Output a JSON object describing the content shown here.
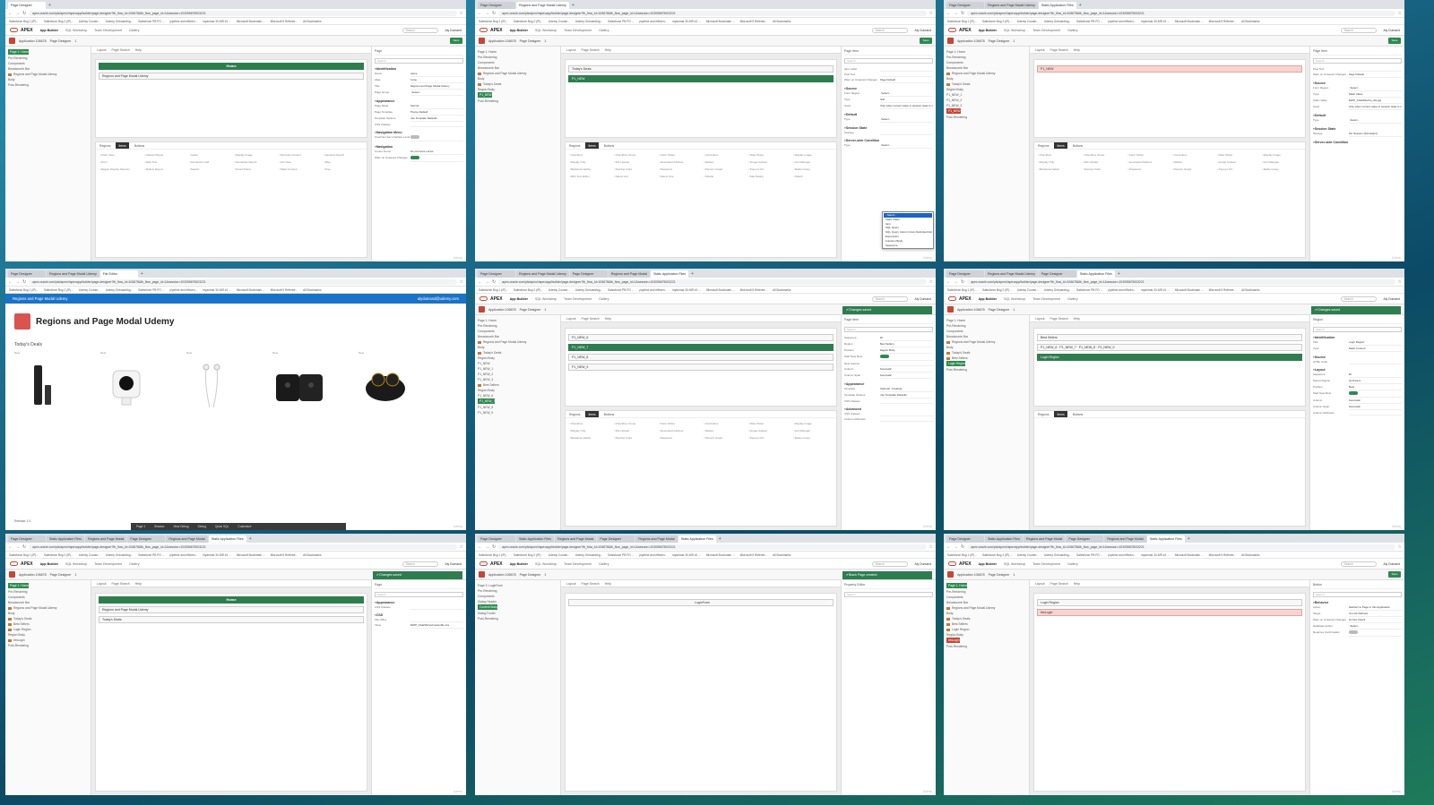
{
  "browser": {
    "url": "apex.oracle.com/pls/apex/r/apexapp/builder/page-designer?fb_flow_id=106678&fb_flow_page_id=1&session=103055675003221",
    "bookmarks": [
      "Salesforce Bug 1 (IP)...",
      "Salesforce Bug 2 (IP)...",
      "Udemy Course...",
      "Udemy Onboarding...",
      "Salesforce PB PO ...",
      "pipeline and efficien...",
      "myanmar 30-MR #1 ...",
      "Microsoft Bookmark ...",
      "Microsoft 5 Referee...",
      "All Bookmarks"
    ]
  },
  "apex": {
    "logo": "APEX",
    "app_builder": "App Builder",
    "nav": [
      "SQL Workshop",
      "Team Development",
      "Gallery"
    ],
    "search_placeholder": "Search",
    "user": "Aly Dumand",
    "app_name": "Application 106678",
    "page_designer": "Page Designer",
    "page_number": "1",
    "save": "Save"
  },
  "tiles": [
    {
      "tabs": [
        "Page Designer"
      ],
      "tree": [
        {
          "t": "Page 1: Home",
          "cls": "sel"
        },
        {
          "t": "Pre-Rendering"
        },
        {
          "t": "Components"
        },
        {
          "t": "Breadcrumb Bar"
        },
        {
          "t": "Regions and Page Modal Udemy",
          "ic": true
        },
        {
          "t": "Body"
        },
        {
          "t": "Post-Rendering"
        }
      ],
      "center_tabs": [
        "Layout",
        "Page Search",
        "Help"
      ],
      "regions": [
        {
          "t": "Home",
          "cls": "band"
        },
        {
          "t": "Regions and Page Modal Udemy"
        }
      ],
      "gallery_tabs": [
        "Regions",
        "Items",
        "Buttons"
      ],
      "gallery_items": [
        "Chart View",
        "Classic Report",
        "Cards",
        "Display Image",
        "Dynamic Content",
        "Faceted Search",
        "Form",
        "Help Text",
        "Interactive Grid",
        "Interactive Report",
        "List View",
        "Map",
        "Region Display Selector",
        "Reflow Report",
        "Search",
        "Smart Filters",
        "Static Content",
        "Tree"
      ],
      "prop_head": "Page",
      "props": [
        {
          "g": "Identification"
        },
        {
          "k": "Name",
          "v": "Home"
        },
        {
          "k": "Alias",
          "v": "home"
        },
        {
          "k": "Title",
          "v": "Regions and Page Modal Udemy"
        },
        {
          "k": "Page Group",
          "v": "- Select -"
        },
        {
          "g": "Appearance"
        },
        {
          "k": "Page Mode",
          "v": "Normal"
        },
        {
          "k": "Page Template",
          "v": "Theme Default"
        },
        {
          "k": "Template Options",
          "v": "Use Template Defaults"
        },
        {
          "k": "CSS Classes",
          "v": ""
        },
        {
          "g": "Navigation Menu"
        },
        {
          "k": "Override User Interface Level",
          "toggle": "off"
        },
        {
          "g": "Navigation"
        },
        {
          "k": "Cursor Focus",
          "v": "Do not focus cursor"
        },
        {
          "k": "Warn on Unsaved Changes",
          "toggle": "on"
        }
      ]
    },
    {
      "tabs": [
        "Page Designer",
        "Regions and Page Modal Udemy"
      ],
      "tree": [
        {
          "t": "Page 1: Home"
        },
        {
          "t": "Pre-Rendering"
        },
        {
          "t": "Components"
        },
        {
          "t": "Breadcrumb Bar"
        },
        {
          "t": "Regions and Page Modal Udemy",
          "ic": true
        },
        {
          "t": "Body"
        },
        {
          "t": "Today's Deals",
          "ic": true
        },
        {
          "t": "Region Body"
        },
        {
          "t": "P1_NEW",
          "cls": "sel"
        },
        {
          "t": "Post-Rendering"
        }
      ],
      "center_tabs": [
        "Layout",
        "Page Search",
        "Help"
      ],
      "regions": [
        {
          "t": "Today's Deals"
        },
        {
          "t": "P1_NEW",
          "cls": "green"
        }
      ],
      "gallery_tabs": [
        "Regions",
        "Items",
        "Buttons"
      ],
      "gallery_items": [
        "Checkbox",
        "Checkbox Group",
        "Color Picker",
        "Combobox",
        "Date Picker",
        "Display Image",
        "Display Only",
        "File Upload",
        "Geocoded Address",
        "Hidden",
        "Image Upload",
        "List Manager",
        "Markdown Editor",
        "Number Field",
        "Password",
        "Percent Graph",
        "Popup LOV",
        "Radio Group",
        "Rich Text Editor",
        "Select List",
        "Select One",
        "Shuttle",
        "Star Rating",
        "Switch"
      ],
      "prop_head": "Page Item",
      "props": [
        {
          "k": "Item Label",
          "v": ""
        },
        {
          "k": "Post Text",
          "v": ""
        },
        {
          "k": "Warn on Unsaved Changes",
          "v": "Page Default"
        },
        {
          "g": "Source"
        },
        {
          "k": "Form Region",
          "v": "- Select -"
        },
        {
          "k": "Type",
          "v": "Null"
        },
        {
          "k": "Used",
          "v": "Only when current value in session state is null"
        },
        {
          "g": "Default"
        },
        {
          "k": "Type",
          "v": "- Select -"
        },
        {
          "g": "Session State"
        },
        {
          "k": "Storage",
          "v": ""
        },
        {
          "g": "Server-side Condition"
        },
        {
          "k": "Type",
          "v": "- Select -"
        }
      ],
      "dropdown": [
        "- Select -",
        "Static Value",
        "Item",
        "SQL Query",
        "SQL Query (return Colon Delimited list)",
        "Expression",
        "Function Body",
        "Sequence"
      ]
    },
    {
      "tabs": [
        "Page Designer",
        "Regions and Page Modal Udemy",
        "Static Application Files"
      ],
      "tree": [
        {
          "t": "Page 1: Home"
        },
        {
          "t": "Pre-Rendering"
        },
        {
          "t": "Components"
        },
        {
          "t": "Breadcrumb Bar"
        },
        {
          "t": "Regions and Page Modal Udemy",
          "ic": true
        },
        {
          "t": "Body"
        },
        {
          "t": "Today's Deals",
          "ic": true
        },
        {
          "t": "Region Body"
        },
        {
          "t": "P1_NEW_1"
        },
        {
          "t": "P1_NEW_2"
        },
        {
          "t": "P1_NEW_3"
        },
        {
          "t": "P1_NEW",
          "cls": "del"
        },
        {
          "t": "Post-Rendering"
        }
      ],
      "center_tabs": [
        "Layout",
        "Page Search",
        "Help"
      ],
      "regions": [
        {
          "t": "P1_NEW",
          "cls": "pink"
        }
      ],
      "gallery_tabs": [
        "Regions",
        "Items",
        "Buttons"
      ],
      "gallery_items": [
        "Checkbox",
        "Checkbox Group",
        "Color Picker",
        "Combobox",
        "Date Picker",
        "Display Image",
        "Display Only",
        "File Upload",
        "Geocoded Address",
        "Hidden",
        "Image Upload",
        "List Manager",
        "Markdown Editor",
        "Number Field",
        "Password",
        "Percent Graph",
        "Popup LOV",
        "Radio Group"
      ],
      "prop_head": "Page Item",
      "props": [
        {
          "k": "Post Text",
          "v": ""
        },
        {
          "k": "Warn on Unsaved Changes",
          "v": "Page Default"
        },
        {
          "g": "Source"
        },
        {
          "k": "Form Region",
          "v": "- Select -"
        },
        {
          "k": "Type",
          "v": "Static Value"
        },
        {
          "k": "Static Value",
          "v": "#APP_FILES#echo_dot.jpg"
        },
        {
          "k": "Used",
          "v": "Only when current value in session state is null"
        },
        {
          "g": "Default"
        },
        {
          "k": "Type",
          "v": "- Select -"
        },
        {
          "g": "Session State"
        },
        {
          "k": "Storage",
          "v": "Per Session (Persistent)"
        },
        {
          "g": "Server-side Condition"
        }
      ]
    },
    {
      "tabs": [
        "Page Designer",
        "Regions and Page Modal Udemy",
        "File Editor"
      ],
      "runtime": true,
      "runtime_header": "Regions and Page Modal Udemy",
      "runtime_user": "alydumand@udemy.com",
      "runtime_title": "Regions and Page Modal Udemy",
      "runtime_section": "Today's Deals",
      "products": [
        {
          "label": "New",
          "kind": "stick"
        },
        {
          "label": "New",
          "kind": "cam"
        },
        {
          "label": "New",
          "kind": "earbuds"
        },
        {
          "label": "New",
          "kind": "blink"
        },
        {
          "label": "New",
          "kind": "buds"
        }
      ],
      "runtime_footer": "Release 1.0",
      "devbar": [
        "Page 1",
        "Session",
        "View Debug",
        "Debug",
        "Quick SQL",
        "Customize"
      ]
    },
    {
      "tabs": [
        "Page Designer",
        "Regions and Page Modal Udemy",
        "Page Designer",
        "Regions and Page Modal",
        "Static Application Files"
      ],
      "toast": "Changes saved",
      "tree": [
        {
          "t": "Page 1: Home"
        },
        {
          "t": "Pre-Rendering"
        },
        {
          "t": "Components"
        },
        {
          "t": "Breadcrumb Bar"
        },
        {
          "t": "Regions and Page Modal Udemy",
          "ic": true
        },
        {
          "t": "Body"
        },
        {
          "t": "Today's Deals",
          "ic": true
        },
        {
          "t": "Region Body"
        },
        {
          "t": "P1_NEW"
        },
        {
          "t": "P1_NEW_1"
        },
        {
          "t": "P1_NEW_2"
        },
        {
          "t": "P1_NEW_3"
        },
        {
          "t": "Best Sellers",
          "ic": true
        },
        {
          "t": "Region Body"
        },
        {
          "t": "P1_NEW_6"
        },
        {
          "t": "P1_NEW_7",
          "cls": "sel"
        },
        {
          "t": "P1_NEW_8"
        },
        {
          "t": "P1_NEW_9"
        }
      ],
      "center_tabs": [
        "Layout",
        "Page Search",
        "Help"
      ],
      "regions": [
        {
          "t": "P1_NEW_6"
        },
        {
          "t": "P1_NEW_7",
          "cls": "green"
        },
        {
          "t": "P1_NEW_8"
        },
        {
          "t": "P1_NEW_9"
        }
      ],
      "gallery_tabs": [
        "Regions",
        "Items",
        "Buttons"
      ],
      "gallery_items": [
        "Checkbox",
        "Checkbox Group",
        "Color Picker",
        "Combobox",
        "Date Picker",
        "Display Image",
        "Display Only",
        "File Upload",
        "Geocoded Address",
        "Hidden",
        "Image Upload",
        "List Manager",
        "Markdown Editor",
        "Number Field",
        "Password",
        "Percent Graph",
        "Popup LOV",
        "Radio Group"
      ],
      "prop_head": "Page Item",
      "props": [
        {
          "k": "Sequence",
          "v": "20"
        },
        {
          "k": "Region",
          "v": "Best Sellers"
        },
        {
          "k": "Position",
          "v": "Region Body"
        },
        {
          "k": "Start New Row",
          "toggle": "on"
        },
        {
          "k": "New Column",
          "v": ""
        },
        {
          "k": "Column",
          "v": "Automatic"
        },
        {
          "k": "Column Span",
          "v": "Automatic"
        },
        {
          "g": "Appearance"
        },
        {
          "k": "Template",
          "v": "Optional - Floating"
        },
        {
          "k": "Template Options",
          "v": "Use Template Defaults"
        },
        {
          "k": "CSS Classes",
          "v": ""
        },
        {
          "g": "Advanced"
        },
        {
          "k": "CSS Classes",
          "v": ""
        },
        {
          "k": "Custom Attributes",
          "v": ""
        }
      ]
    },
    {
      "tabs": [
        "Page Designer",
        "Regions and Page Modal Udemy",
        "Page Designer",
        "Static Application Files"
      ],
      "toast": "Changes saved",
      "tree": [
        {
          "t": "Page 1: Home"
        },
        {
          "t": "Pre-Rendering"
        },
        {
          "t": "Components"
        },
        {
          "t": "Breadcrumb Bar"
        },
        {
          "t": "Regions and Page Modal Udemy",
          "ic": true
        },
        {
          "t": "Body"
        },
        {
          "t": "Today's Deals",
          "ic": true
        },
        {
          "t": "Best Sellers",
          "ic": true
        },
        {
          "t": "Login Region",
          "cls": "sel"
        },
        {
          "t": "Post-Rendering"
        }
      ],
      "center_tabs": [
        "Layout",
        "Page Search",
        "Help"
      ],
      "regions": [
        {
          "t": "Best Sellers"
        },
        {
          "t": "P1_NEW_6 · P1_NEW_7 · P1_NEW_8 · P1_NEW_9"
        },
        {
          "t": "Login Region",
          "cls": "green"
        }
      ],
      "gallery_tabs": [
        "Regions",
        "Items",
        "Buttons"
      ],
      "gallery_items": [],
      "prop_head": "Region",
      "props": [
        {
          "g": "Identification"
        },
        {
          "k": "Title",
          "v": "Login Region"
        },
        {
          "k": "Type",
          "v": "Static Content"
        },
        {
          "g": "Source"
        },
        {
          "k": "HTML Code",
          "v": ""
        },
        {
          "g": "Layout"
        },
        {
          "k": "Sequence",
          "v": "30"
        },
        {
          "k": "Parent Region",
          "v": "No Parent"
        },
        {
          "k": "Position",
          "v": "Body"
        },
        {
          "k": "Start New Row",
          "toggle": "on"
        },
        {
          "k": "Column",
          "v": "Automatic"
        },
        {
          "k": "Column Span",
          "v": "Automatic"
        },
        {
          "k": "Column Attributes",
          "v": ""
        }
      ]
    },
    {
      "tabs": [
        "Page Designer",
        "Static Application Files",
        "Regions and Page Modal",
        "Page Designer",
        "Regions and Page Modal",
        "Static Application Files"
      ],
      "toast": "Changes saved",
      "tree": [
        {
          "t": "Page 1: Home",
          "cls": "sel"
        },
        {
          "t": "Pre-Rendering"
        },
        {
          "t": "Components"
        },
        {
          "t": "Breadcrumb Bar"
        },
        {
          "t": "Regions and Page Modal Udemy",
          "ic": true
        },
        {
          "t": "Body"
        },
        {
          "t": "Today's Deals",
          "ic": true
        },
        {
          "t": "Best Sellers",
          "ic": true
        },
        {
          "t": "Login Region",
          "ic": true
        },
        {
          "t": "Region Body"
        },
        {
          "t": "btnLogin",
          "ic": true
        },
        {
          "t": "Post-Rendering"
        }
      ],
      "center_tabs": [
        "Layout",
        "Page Search",
        "Help"
      ],
      "regions": [
        {
          "t": "Home",
          "cls": "band"
        },
        {
          "t": "Regions and Page Modal Udemy"
        },
        {
          "t": "Today's Deals"
        }
      ],
      "gallery_tabs": [],
      "gallery_items": [],
      "prop_head": "Page",
      "props": [
        {
          "g": "Appearance"
        },
        {
          "k": "CSS Classes",
          "v": ""
        },
        {
          "g": "CSS"
        },
        {
          "k": "File URLs",
          "v": ""
        },
        {
          "k": "Inline",
          "v": "#APP_FILES#css/customfile.css"
        }
      ]
    },
    {
      "tabs": [
        "Page Designer",
        "Static Application Files",
        "Regions and Page Modal",
        "Page Designer",
        "Regions and Page Modal",
        "Static Application Files"
      ],
      "toast": "Blank Page created.",
      "tree": [
        {
          "t": "Page 2: LoginForm"
        },
        {
          "t": "Pre-Rendering"
        },
        {
          "t": "Components"
        },
        {
          "t": "Dialog Header"
        },
        {
          "t": "Content Body",
          "cls": "sel"
        },
        {
          "t": "Dialog Footer"
        },
        {
          "t": "Post-Rendering"
        }
      ],
      "center_tabs": [
        "Layout",
        "Page Search",
        "Help"
      ],
      "regions": [
        {
          "t": "LoginForm",
          "cls": "white"
        }
      ],
      "gallery_tabs": [],
      "gallery_items": [],
      "prop_head": "Property Editor",
      "props": [],
      "empty_msg": "No component currently selected"
    },
    {
      "tabs": [
        "Page Designer",
        "Static Application Files",
        "Regions and Page Modal",
        "Page Designer",
        "Regions and Page Modal",
        "Static Application Files"
      ],
      "tree": [
        {
          "t": "Page 1: Home",
          "cls": "sel"
        },
        {
          "t": "Pre-Rendering"
        },
        {
          "t": "Components"
        },
        {
          "t": "Breadcrumb Bar"
        },
        {
          "t": "Regions and Page Modal Udemy",
          "ic": true
        },
        {
          "t": "Body"
        },
        {
          "t": "Today's Deals",
          "ic": true
        },
        {
          "t": "Best Sellers",
          "ic": true
        },
        {
          "t": "Login Region",
          "ic": true
        },
        {
          "t": "Region Body"
        },
        {
          "t": "btnLogin",
          "cls": "del"
        },
        {
          "t": "Post-Rendering"
        }
      ],
      "center_tabs": [
        "Layout",
        "Page Search",
        "Help"
      ],
      "regions": [
        {
          "t": "Login Region"
        },
        {
          "t": "btnLogin",
          "cls": "pink"
        }
      ],
      "gallery_tabs": [],
      "gallery_items": [],
      "prop_head": "Button",
      "props": [
        {
          "g": "Behavior"
        },
        {
          "k": "Action",
          "v": "Redirect to Page in this Application"
        },
        {
          "k": "Target",
          "v": "No Link Defined"
        },
        {
          "k": "Warn on Unsaved Changes",
          "v": "Do Not Check"
        },
        {
          "k": "Database Action",
          "v": "- Select -"
        },
        {
          "k": "Requires Confirmation",
          "toggle": "off"
        }
      ]
    }
  ],
  "brand": "Udemy"
}
